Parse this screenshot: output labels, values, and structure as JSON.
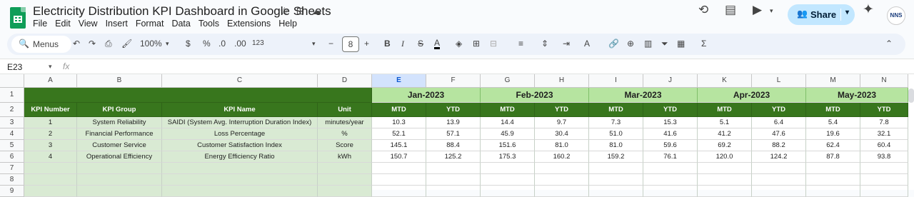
{
  "document": {
    "title": "Electricity Distribution KPI Dashboard in Google Sheets",
    "menu": [
      "File",
      "Edit",
      "View",
      "Insert",
      "Format",
      "Data",
      "Tools",
      "Extensions",
      "Help"
    ],
    "share_label": "Share",
    "avatar_text": "NNS"
  },
  "toolbar": {
    "menus_label": "Menus",
    "zoom": "100%",
    "currency": "$",
    "percent": "%",
    "dec_decrease": ".0",
    "dec_increase": ".00",
    "number_format": "123",
    "font_size": "8"
  },
  "formula_bar": {
    "cell_ref": "E23",
    "fx": "fx"
  },
  "columns": [
    "A",
    "B",
    "C",
    "D",
    "E",
    "F",
    "G",
    "H",
    "I",
    "J",
    "K",
    "L",
    "M",
    "N"
  ],
  "selected_column": "E",
  "rows": [
    "1",
    "2",
    "3",
    "4",
    "5",
    "6",
    "7",
    "8",
    "9"
  ],
  "months": [
    "Jan-2023",
    "Feb-2023",
    "Mar-2023",
    "Apr-2023",
    "May-2023"
  ],
  "header": {
    "kpi_number": "KPI Number",
    "kpi_group": "KPI Group",
    "kpi_name": "KPI Name",
    "unit": "Unit",
    "mtd": "MTD",
    "ytd": "YTD"
  },
  "kpis": [
    {
      "number": "1",
      "group": "System Reliability",
      "name": "SAIDI (System Avg. Interruption Duration Index)",
      "unit": "minutes/year",
      "values": [
        "10.3",
        "13.9",
        "14.4",
        "9.7",
        "7.3",
        "15.3",
        "5.1",
        "6.4",
        "5.4",
        "7.8"
      ]
    },
    {
      "number": "2",
      "group": "Financial Performance",
      "name": "Loss Percentage",
      "unit": "%",
      "values": [
        "52.1",
        "57.1",
        "45.9",
        "30.4",
        "51.0",
        "41.6",
        "41.2",
        "47.6",
        "19.6",
        "32.1"
      ]
    },
    {
      "number": "3",
      "group": "Customer Service",
      "name": "Customer Satisfaction Index",
      "unit": "Score",
      "values": [
        "145.1",
        "88.4",
        "151.6",
        "81.0",
        "81.0",
        "59.6",
        "69.2",
        "88.2",
        "62.4",
        "60.4"
      ]
    },
    {
      "number": "4",
      "group": "Operational Efficiency",
      "name": "Energy Efficiency Ratio",
      "unit": "kWh",
      "values": [
        "150.7",
        "125.2",
        "175.3",
        "160.2",
        "159.2",
        "76.1",
        "120.0",
        "124.2",
        "87.8",
        "93.8"
      ]
    }
  ],
  "colors": {
    "header_green": "#38761d",
    "month_green": "#b6e4a0",
    "pale_green": "#d9ead3",
    "share_blue": "#c2e7ff"
  }
}
